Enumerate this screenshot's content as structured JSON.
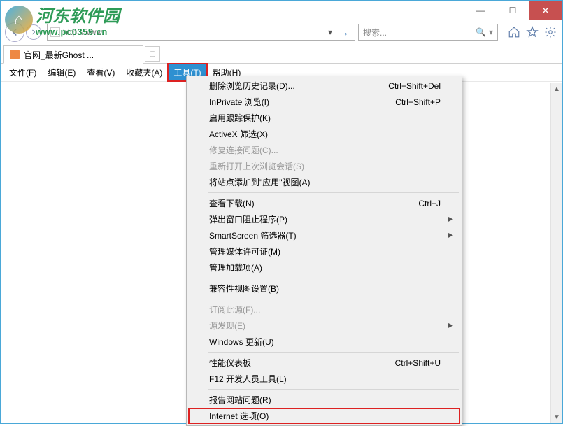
{
  "watermark": {
    "title": "河东软件园",
    "url": "www.pc0359.cn"
  },
  "window": {
    "min": "—",
    "max": "☐",
    "close": "✕"
  },
  "addr": {
    "url_prefix": "http://www.",
    "search_placeholder": "搜索...",
    "search_dd": "▾"
  },
  "tab": {
    "title": "官网_最新Ghost ..."
  },
  "menubar": {
    "items": [
      {
        "label": "文件(F)"
      },
      {
        "label": "编辑(E)"
      },
      {
        "label": "查看(V)"
      },
      {
        "label": "收藏夹(A)"
      },
      {
        "label": "工具(T)",
        "active": true
      },
      {
        "label": "帮助(H)"
      }
    ]
  },
  "dropdown": {
    "groups": [
      [
        {
          "label": "删除浏览历史记录(D)...",
          "shortcut": "Ctrl+Shift+Del"
        },
        {
          "label": "InPrivate 浏览(I)",
          "shortcut": "Ctrl+Shift+P"
        },
        {
          "label": "启用跟踪保护(K)"
        },
        {
          "label": "ActiveX 筛选(X)"
        },
        {
          "label": "修复连接问题(C)...",
          "disabled": true
        },
        {
          "label": "重新打开上次浏览会话(S)",
          "disabled": true
        },
        {
          "label": "将站点添加到\"应用\"视图(A)"
        }
      ],
      [
        {
          "label": "查看下载(N)",
          "shortcut": "Ctrl+J"
        },
        {
          "label": "弹出窗口阻止程序(P)",
          "submenu": true
        },
        {
          "label": "SmartScreen 筛选器(T)",
          "submenu": true
        },
        {
          "label": "管理媒体许可证(M)"
        },
        {
          "label": "管理加载项(A)"
        }
      ],
      [
        {
          "label": "兼容性视图设置(B)"
        }
      ],
      [
        {
          "label": "订阅此源(F)...",
          "disabled": true
        },
        {
          "label": "源发现(E)",
          "submenu": true,
          "disabled": true
        },
        {
          "label": "Windows 更新(U)"
        }
      ],
      [
        {
          "label": "性能仪表板",
          "shortcut": "Ctrl+Shift+U"
        },
        {
          "label": "F12 开发人员工具(L)"
        }
      ],
      [
        {
          "label": "报告网站问题(R)"
        },
        {
          "label": "Internet 选项(O)",
          "highlight": true
        }
      ]
    ]
  }
}
